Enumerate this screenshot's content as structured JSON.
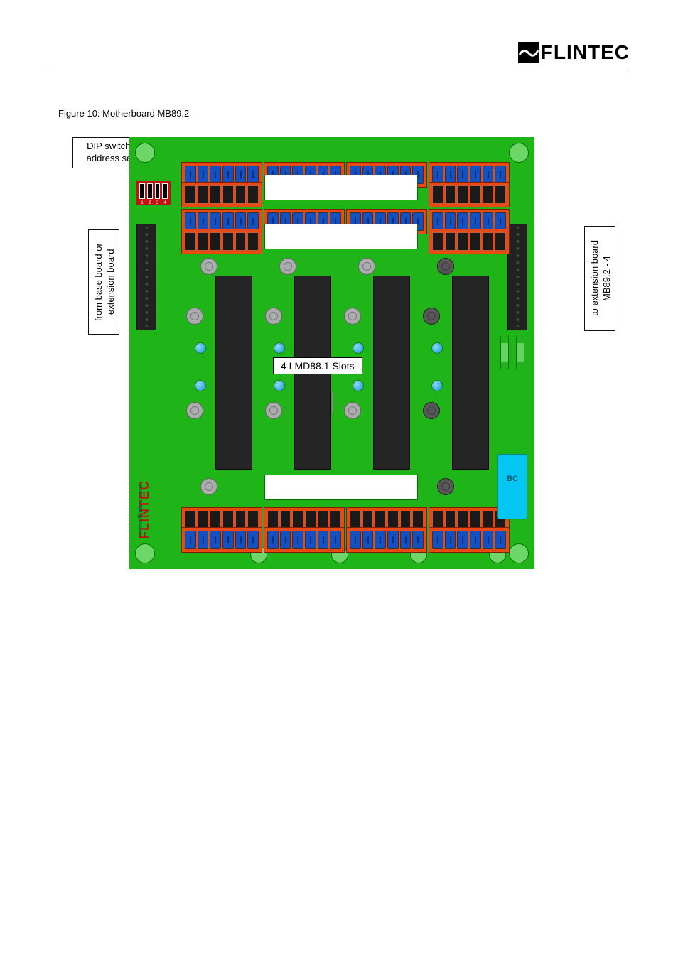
{
  "header": {
    "brand": "FLINTEC"
  },
  "figure": {
    "caption": "Figure 10: Motherboard MB89.2"
  },
  "callouts": {
    "dip": "DIP switches for address settings",
    "left": "from base board or extension board",
    "right": "to extension board MB89.2 - 4",
    "slots": "4 LMD88.1 Slots"
  },
  "board": {
    "brand": "FLINTEC",
    "url": "www.flintec.com",
    "bc": "BC",
    "dip_numbers": [
      "1",
      "2",
      "3",
      "4"
    ]
  }
}
